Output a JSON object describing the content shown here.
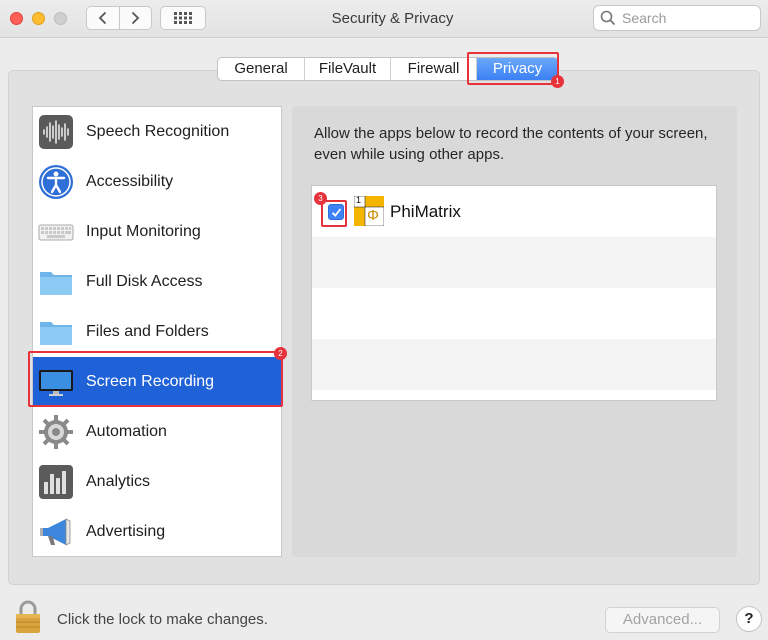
{
  "window": {
    "title": "Security & Privacy",
    "search_placeholder": "Search"
  },
  "tabs": [
    {
      "label": "General"
    },
    {
      "label": "FileVault"
    },
    {
      "label": "Firewall"
    },
    {
      "label": "Privacy",
      "selected": true
    }
  ],
  "sidebar": {
    "items": [
      {
        "label": "Speech Recognition",
        "icon": "waveform-icon"
      },
      {
        "label": "Accessibility",
        "icon": "accessibility-icon"
      },
      {
        "label": "Input Monitoring",
        "icon": "keyboard-icon"
      },
      {
        "label": "Full Disk Access",
        "icon": "folder-icon"
      },
      {
        "label": "Files and Folders",
        "icon": "folder-icon"
      },
      {
        "label": "Screen Recording",
        "icon": "monitor-icon",
        "selected": true
      },
      {
        "label": "Automation",
        "icon": "gear-icon"
      },
      {
        "label": "Analytics",
        "icon": "bar-chart-icon"
      },
      {
        "label": "Advertising",
        "icon": "megaphone-icon"
      }
    ]
  },
  "content": {
    "description": "Allow the apps below to record the contents of your screen, even while using other apps.",
    "apps": [
      {
        "name": "PhiMatrix",
        "checked": true,
        "icon_top": "1",
        "icon_symbol": "Φ"
      }
    ]
  },
  "footer": {
    "lock_text": "Click the lock to make changes.",
    "advanced_label": "Advanced...",
    "help_label": "?"
  },
  "annotations": {
    "badge_1": "1",
    "badge_2": "2",
    "badge_3": "3"
  },
  "colors": {
    "selection": "#1f61d6",
    "tab_selected": "#3b80f5",
    "highlight": "#e5323b",
    "checkbox": "#3d82f6"
  }
}
